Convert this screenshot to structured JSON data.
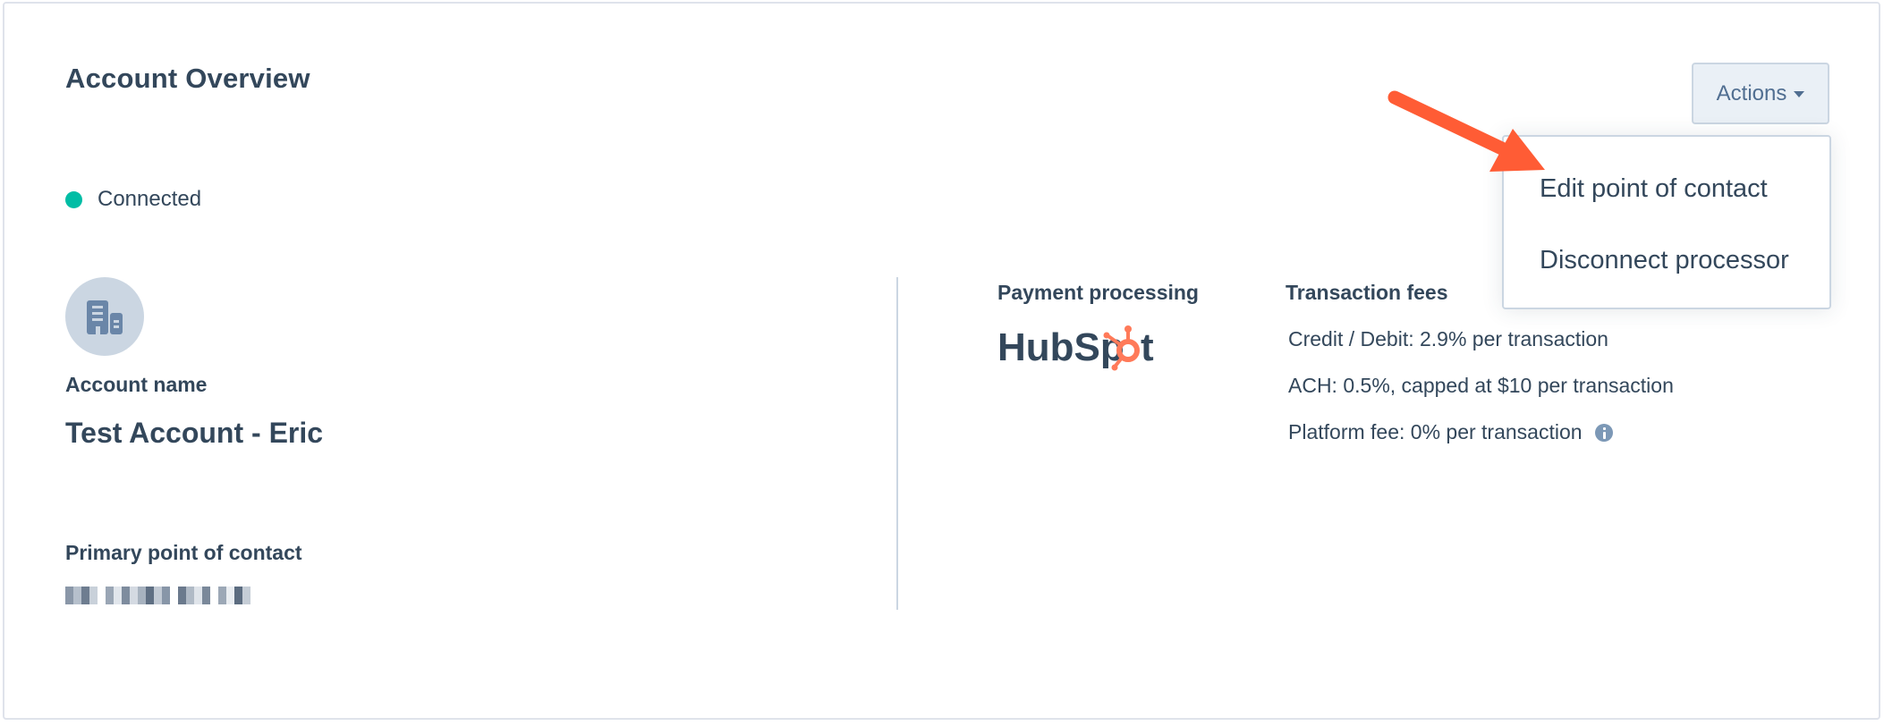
{
  "header": {
    "title": "Account Overview",
    "actions_label": "Actions"
  },
  "dropdown": {
    "items": [
      {
        "label": "Edit point of contact"
      },
      {
        "label": "Disconnect processor"
      }
    ]
  },
  "status": {
    "label": "Connected",
    "color": "#00bda5"
  },
  "account": {
    "name_label": "Account name",
    "name_value": "Test Account - Eric",
    "contact_label": "Primary point of contact",
    "contact_value_redacted": true
  },
  "payment": {
    "processing_label": "Payment processing",
    "processor_logo": "HubSpot"
  },
  "fees": {
    "label": "Transaction fees",
    "lines": [
      "Credit / Debit: 2.9% per transaction",
      "ACH: 0.5%, capped at $10 per transaction",
      "Platform fee: 0% per transaction"
    ]
  },
  "colors": {
    "text": "#33475b",
    "accent_arrow": "#ff5c35",
    "hubspot_orange": "#ff7a59",
    "connected": "#00bda5"
  }
}
